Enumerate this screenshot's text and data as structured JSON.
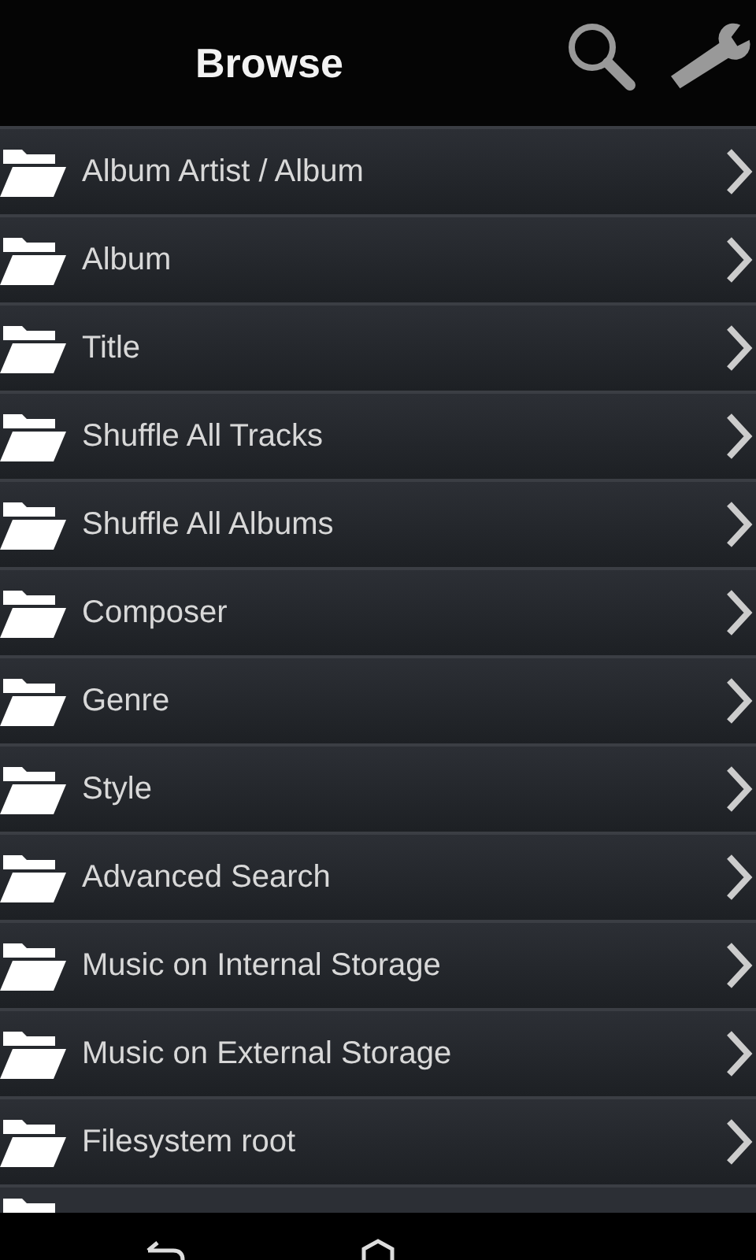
{
  "header": {
    "title": "Browse"
  },
  "items": [
    {
      "label": "Album Artist / Album"
    },
    {
      "label": "Album"
    },
    {
      "label": "Title"
    },
    {
      "label": "Shuffle All Tracks"
    },
    {
      "label": "Shuffle All Albums"
    },
    {
      "label": "Composer"
    },
    {
      "label": "Genre"
    },
    {
      "label": "Style"
    },
    {
      "label": "Advanced Search"
    },
    {
      "label": "Music on Internal Storage"
    },
    {
      "label": "Music on External Storage"
    },
    {
      "label": "Filesystem root"
    }
  ]
}
